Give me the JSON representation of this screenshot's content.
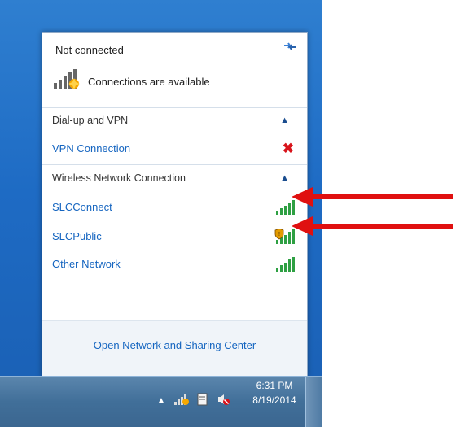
{
  "flyout": {
    "status_title": "Not connected",
    "availability_text": "Connections are available",
    "sections": {
      "dialup": {
        "header": "Dial-up and VPN",
        "items": [
          {
            "label": "VPN Connection",
            "status": "disconnected"
          }
        ]
      },
      "wireless": {
        "header": "Wireless Network Connection",
        "items": [
          {
            "label": "SLCConnect",
            "secured": false
          },
          {
            "label": "SLCPublic",
            "secured": true
          },
          {
            "label": "Other Network",
            "secured": false
          }
        ]
      }
    },
    "footer_link": "Open Network and Sharing Center"
  },
  "taskbar": {
    "time": "6:31 PM",
    "date": "8/19/2014"
  },
  "colors": {
    "link": "#1565c0",
    "desktop": "#1e6bc4",
    "annotation_arrow": "#e01010",
    "signal_green": "#2ea043"
  },
  "icons": [
    "refresh-icon",
    "network-available-icon",
    "chevron-up-icon",
    "red-x-icon",
    "signal-icon",
    "shield-icon",
    "tray-network-icon",
    "tray-action-center-icon",
    "tray-volume-muted-icon"
  ]
}
